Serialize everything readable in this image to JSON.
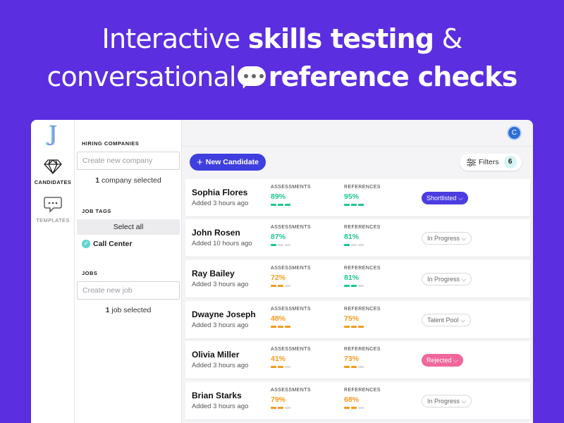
{
  "headline": {
    "line1_pre": "Interactive ",
    "line1_bold": "skills testing",
    "line1_post": " &",
    "line2_pre": "conversational",
    "line2_bold": "reference checks",
    "bubble_icon": "speech-bubble-icon"
  },
  "app": {
    "logo": "J",
    "avatar_initial": "C",
    "rail": [
      {
        "label": "CANDIDATES",
        "icon": "diamond-icon",
        "active": true
      },
      {
        "label": "TEMPLATES",
        "icon": "chat-icon",
        "active": false
      }
    ],
    "filters": {
      "hiring_companies_title": "HIRING COMPANIES",
      "company_placeholder": "Create new company",
      "company_count": "1",
      "company_count_suffix": " company selected",
      "job_tags_title": "JOB TAGS",
      "select_all": "Select all",
      "tag": "Call Center",
      "jobs_title": "JOBS",
      "job_placeholder": "Create new job",
      "job_count": "1",
      "job_count_suffix": " job selected"
    },
    "toolbar": {
      "new_candidate": "New Candidate",
      "filters_label": "Filters",
      "filters_count": "6"
    },
    "column_labels": {
      "assessments": "ASSESSMENTS",
      "references": "REFERENCES"
    },
    "colors": {
      "brand": "#5b2ee0",
      "good": "#1fc490",
      "warn": "#f39a1e",
      "bar_empty": "#dcdce2",
      "shortlisted": "#4b3de0",
      "rejected": "#f0679b"
    },
    "candidates": [
      {
        "name": "Sophia Flores",
        "added": "Added 3 hours ago",
        "assessment": "89%",
        "assessment_fill": 3,
        "reference": "95%",
        "reference_fill": 3,
        "status": "Shortlisted",
        "status_style": "shortlisted"
      },
      {
        "name": "John Rosen",
        "added": "Added 10 hours ago",
        "assessment": "87%",
        "assessment_fill": 1,
        "reference": "81%",
        "reference_fill": 1,
        "status": "In Progress",
        "status_style": "default"
      },
      {
        "name": "Ray Bailey",
        "added": "Added 3 hours ago",
        "assessment": "72%",
        "assessment_fill": 2,
        "reference": "81%",
        "reference_fill": 2,
        "status": "In Progress",
        "status_style": "default"
      },
      {
        "name": "Dwayne Joseph",
        "added": "Added 3 hours ago",
        "assessment": "48%",
        "assessment_fill": 3,
        "reference": "75%",
        "reference_fill": 3,
        "status": "Talent Pool",
        "status_style": "default"
      },
      {
        "name": "Olivia Miller",
        "added": "Added 3 hours ago",
        "assessment": "41%",
        "assessment_fill": 2,
        "reference": "73%",
        "reference_fill": 2,
        "status": "Rejected",
        "status_style": "rejected"
      },
      {
        "name": "Brian Starks",
        "added": "Added 3 hours ago",
        "assessment": "79%",
        "assessment_fill": 2,
        "reference": "68%",
        "reference_fill": 2,
        "status": "In Progress",
        "status_style": "default"
      }
    ],
    "value_colors": [
      {
        "assessment": "#1fc490",
        "reference": "#1fc490"
      },
      {
        "assessment": "#1fc490",
        "reference": "#1fc490"
      },
      {
        "assessment": "#f39a1e",
        "reference": "#1fc490"
      },
      {
        "assessment": "#f39a1e",
        "reference": "#f39a1e"
      },
      {
        "assessment": "#f39a1e",
        "reference": "#f39a1e"
      },
      {
        "assessment": "#f39a1e",
        "reference": "#f39a1e"
      }
    ]
  }
}
